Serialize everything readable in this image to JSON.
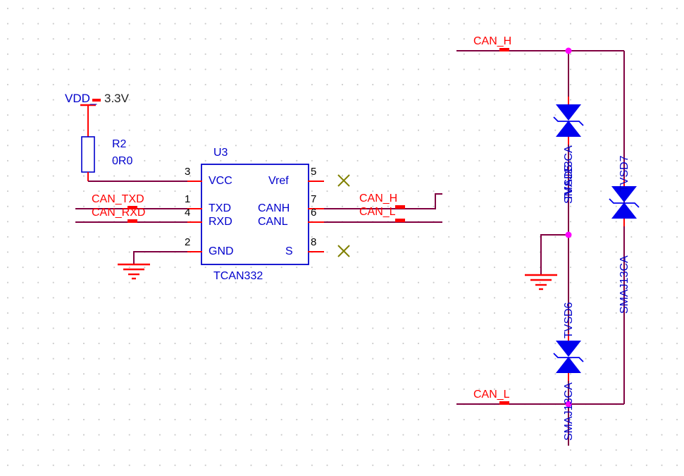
{
  "sheet": {
    "title": "CAN transceiver schematic",
    "background": "#ffffff",
    "grid_color": "#c8c8c8",
    "wire_color": "#800040",
    "pin_color": "#ff0000",
    "symbol_color": "#0000cc",
    "junction_color": "#ff00ff",
    "nc_color": "#808000"
  },
  "power": {
    "name": "VDD_",
    "voltage_comment": "3.3V"
  },
  "resistor": {
    "designator": "R2",
    "value": "0R0"
  },
  "ic": {
    "designator": "U3",
    "part_number": "TCAN332",
    "pins_left": [
      {
        "number": "3",
        "name": "VCC"
      },
      {
        "number": "1",
        "name": "TXD"
      },
      {
        "number": "4",
        "name": "RXD"
      },
      {
        "number": "2",
        "name": "GND"
      }
    ],
    "pins_right": [
      {
        "number": "5",
        "name": "Vref"
      },
      {
        "number": "7",
        "name": "CANH"
      },
      {
        "number": "6",
        "name": "CANL"
      },
      {
        "number": "8",
        "name": "S"
      }
    ]
  },
  "net_labels": {
    "can_txd": "CAN_TXD",
    "can_rxd": "CAN_RXD",
    "can_h_ic": "CAN_H",
    "can_l_ic": "CAN_L",
    "can_h_tvs": "CAN_H",
    "can_l_tvs": "CAN_L"
  },
  "tvs_diodes": [
    {
      "designator": "TVSD5",
      "part_number": "SMAJ13CA"
    },
    {
      "designator": "TVSD7",
      "part_number": "SMAJ13CA"
    },
    {
      "designator": "TVSD6",
      "part_number": "SMAJ13CA"
    }
  ],
  "ground_symbols": [
    {
      "name": "gnd-ic"
    },
    {
      "name": "gnd-tvs"
    }
  ],
  "no_connects": [
    {
      "name": "nc-vref"
    },
    {
      "name": "nc-s"
    }
  ]
}
